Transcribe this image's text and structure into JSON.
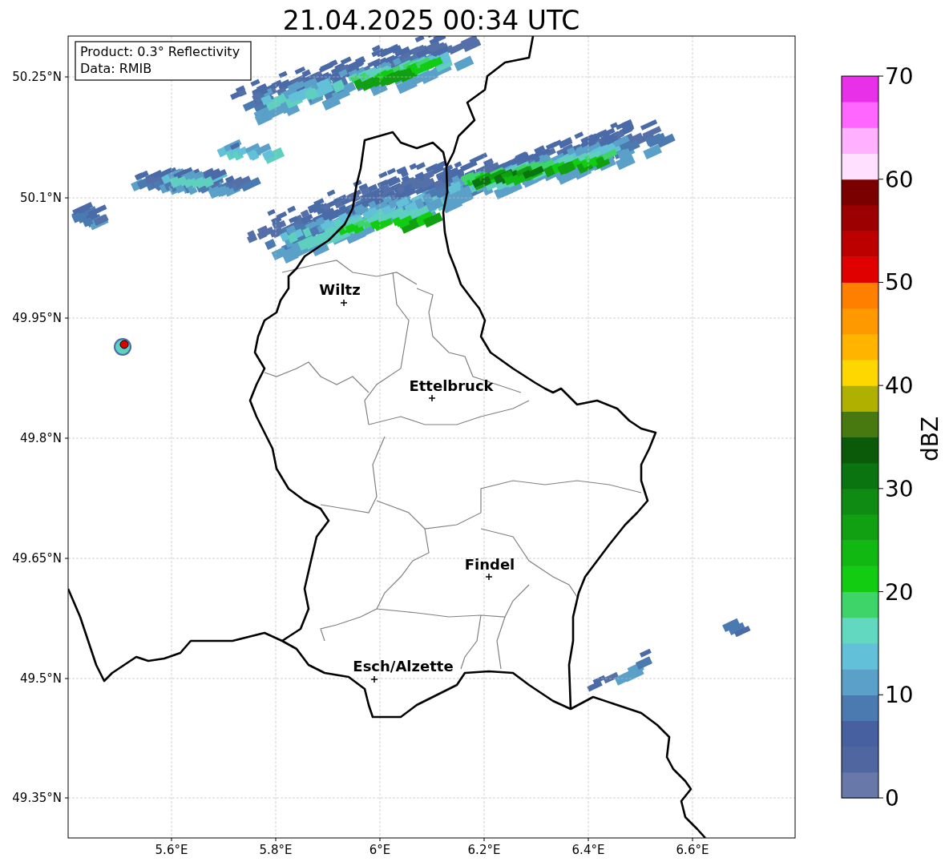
{
  "title": "21.04.2025 00:34 UTC",
  "legend": {
    "lines": [
      "Product: 0.3° Reflectivity",
      "Data: RMIB"
    ]
  },
  "map": {
    "y_ticks": [
      "50.25°N",
      "50.1°N",
      "49.95°N",
      "49.8°N",
      "49.65°N",
      "49.5°N",
      "49.35°N"
    ],
    "x_ticks": [
      "5.6°E",
      "5.8°E",
      "6°E",
      "6.2°E",
      "6.4°E",
      "6.6°E"
    ],
    "cities": [
      {
        "name": "Wiltz"
      },
      {
        "name": "Ettelbruck"
      },
      {
        "name": "Findel"
      },
      {
        "name": "Esch/Alzette"
      }
    ]
  },
  "colorbar": {
    "label": "dBZ",
    "ticks": [
      "70",
      "60",
      "50",
      "40",
      "30",
      "20",
      "10",
      "0"
    ],
    "bands": [
      {
        "color": "#6878a8"
      },
      {
        "color": "#5066a0"
      },
      {
        "color": "#4660a0"
      },
      {
        "color": "#4a7ab0"
      },
      {
        "color": "#5aa0c8"
      },
      {
        "color": "#62c0d8"
      },
      {
        "color": "#62d8c0"
      },
      {
        "color": "#3ed46a"
      },
      {
        "color": "#12cc12"
      },
      {
        "color": "#12b812"
      },
      {
        "color": "#10a012"
      },
      {
        "color": "#0f8a12"
      },
      {
        "color": "#0a7410"
      },
      {
        "color": "#0a5a0a"
      },
      {
        "color": "#487810"
      },
      {
        "color": "#b0b000"
      },
      {
        "color": "#ffd700"
      },
      {
        "color": "#ffb400"
      },
      {
        "color": "#ff9900"
      },
      {
        "color": "#ff7f00"
      },
      {
        "color": "#e00000"
      },
      {
        "color": "#bc0000"
      },
      {
        "color": "#9c0000"
      },
      {
        "color": "#7a0000"
      },
      {
        "color": "#ffe0ff"
      },
      {
        "color": "#ffb0ff"
      },
      {
        "color": "#ff66ff"
      },
      {
        "color": "#e830e8"
      }
    ]
  }
}
